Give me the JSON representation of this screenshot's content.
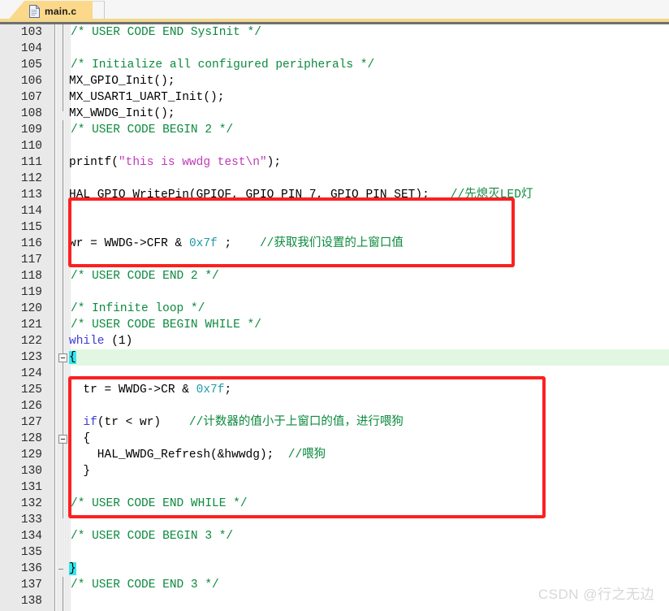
{
  "window": {
    "tab": {
      "label": "main.c",
      "icon": "document-icon",
      "active": true
    }
  },
  "editor": {
    "first_line": 103,
    "current_line": 123,
    "gutter_background": "#e9e9e9",
    "background": "#ffffff",
    "colors": {
      "comment": "#0c8a3e",
      "keyword": "#3b3bd6",
      "number": "#1f9aa8",
      "string": "#c03bb9",
      "brace_match_bg": "#36e7f0",
      "current_line_bg": "#e2f7e2",
      "annotation_red": "#fc2020",
      "tab_active": "#fcd88a"
    },
    "lines": [
      {
        "n": 103,
        "text": "/* USER CODE END SysInit */"
      },
      {
        "n": 104,
        "text": ""
      },
      {
        "n": 105,
        "text": "/* Initialize all configured peripherals */"
      },
      {
        "n": 106,
        "text": "MX_GPIO_Init();"
      },
      {
        "n": 107,
        "text": "MX_USART1_UART_Init();"
      },
      {
        "n": 108,
        "text": "MX_WWDG_Init();"
      },
      {
        "n": 109,
        "text": "/* USER CODE BEGIN 2 */"
      },
      {
        "n": 110,
        "text": ""
      },
      {
        "n": 111,
        "text": "printf(\"this is wwdg test\\n\");"
      },
      {
        "n": 112,
        "text": ""
      },
      {
        "n": 113,
        "text": "HAL_GPIO_WritePin(GPIOF, GPIO_PIN_7, GPIO_PIN_SET);   //先熄灭LED灯"
      },
      {
        "n": 114,
        "text": ""
      },
      {
        "n": 115,
        "text": ""
      },
      {
        "n": 116,
        "text": "wr = WWDG->CFR & 0x7f ;    //获取我们设置的上窗口值"
      },
      {
        "n": 117,
        "text": ""
      },
      {
        "n": 118,
        "text": "/* USER CODE END 2 */"
      },
      {
        "n": 119,
        "text": ""
      },
      {
        "n": 120,
        "text": "/* Infinite loop */"
      },
      {
        "n": 121,
        "text": "/* USER CODE BEGIN WHILE */"
      },
      {
        "n": 122,
        "text": "while (1)"
      },
      {
        "n": 123,
        "text": "{"
      },
      {
        "n": 124,
        "text": ""
      },
      {
        "n": 125,
        "text": "  tr = WWDG->CR & 0x7f;"
      },
      {
        "n": 126,
        "text": ""
      },
      {
        "n": 127,
        "text": "  if(tr < wr)    //计数器的值小于上窗口的值，进行喂狗"
      },
      {
        "n": 128,
        "text": "  {"
      },
      {
        "n": 129,
        "text": "    HAL_WWDG_Refresh(&hwwdg);  //喂狗"
      },
      {
        "n": 130,
        "text": "  }"
      },
      {
        "n": 131,
        "text": ""
      },
      {
        "n": 132,
        "text": "/* USER CODE END WHILE */"
      },
      {
        "n": 133,
        "text": ""
      },
      {
        "n": 134,
        "text": "/* USER CODE BEGIN 3 */"
      },
      {
        "n": 135,
        "text": ""
      },
      {
        "n": 136,
        "text": "}"
      },
      {
        "n": 137,
        "text": "/* USER CODE END 3 */"
      },
      {
        "n": 138,
        "text": ""
      }
    ],
    "fold_markers": [
      123,
      128,
      136
    ]
  },
  "annotations": [
    {
      "name": "red-box-upper",
      "encloses_lines": "114-117"
    },
    {
      "name": "red-box-lower",
      "encloses_lines": "124-132"
    }
  ],
  "watermark": {
    "text": "CSDN @行之无边"
  }
}
